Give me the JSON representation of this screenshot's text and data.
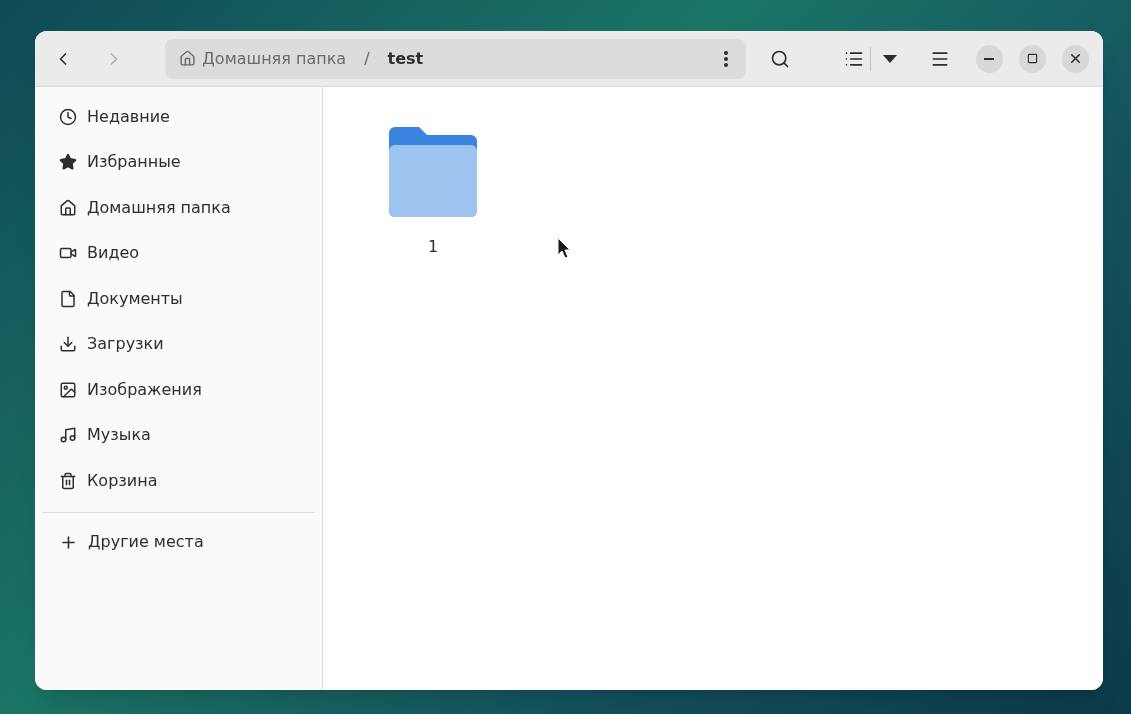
{
  "header": {
    "back": {
      "disabled": false
    },
    "forward": {
      "disabled": true
    },
    "path": [
      {
        "label": "Домашняя папка",
        "kind": "home",
        "current": false
      },
      {
        "label": "test",
        "kind": "folder",
        "current": true
      }
    ],
    "separator": "/"
  },
  "sidebar": {
    "places": [
      {
        "label": "Недавние",
        "kind": "recent"
      },
      {
        "label": "Избранные",
        "kind": "starred"
      },
      {
        "label": "Домашняя папка",
        "kind": "home"
      },
      {
        "label": "Видео",
        "kind": "videos"
      },
      {
        "label": "Документы",
        "kind": "documents"
      },
      {
        "label": "Загрузки",
        "kind": "downloads"
      },
      {
        "label": "Изображения",
        "kind": "pictures"
      },
      {
        "label": "Музыка",
        "kind": "music"
      },
      {
        "label": "Корзина",
        "kind": "trash"
      }
    ],
    "other": {
      "label": "Другие места"
    }
  },
  "files": [
    {
      "name": "1",
      "kind": "folder"
    }
  ]
}
